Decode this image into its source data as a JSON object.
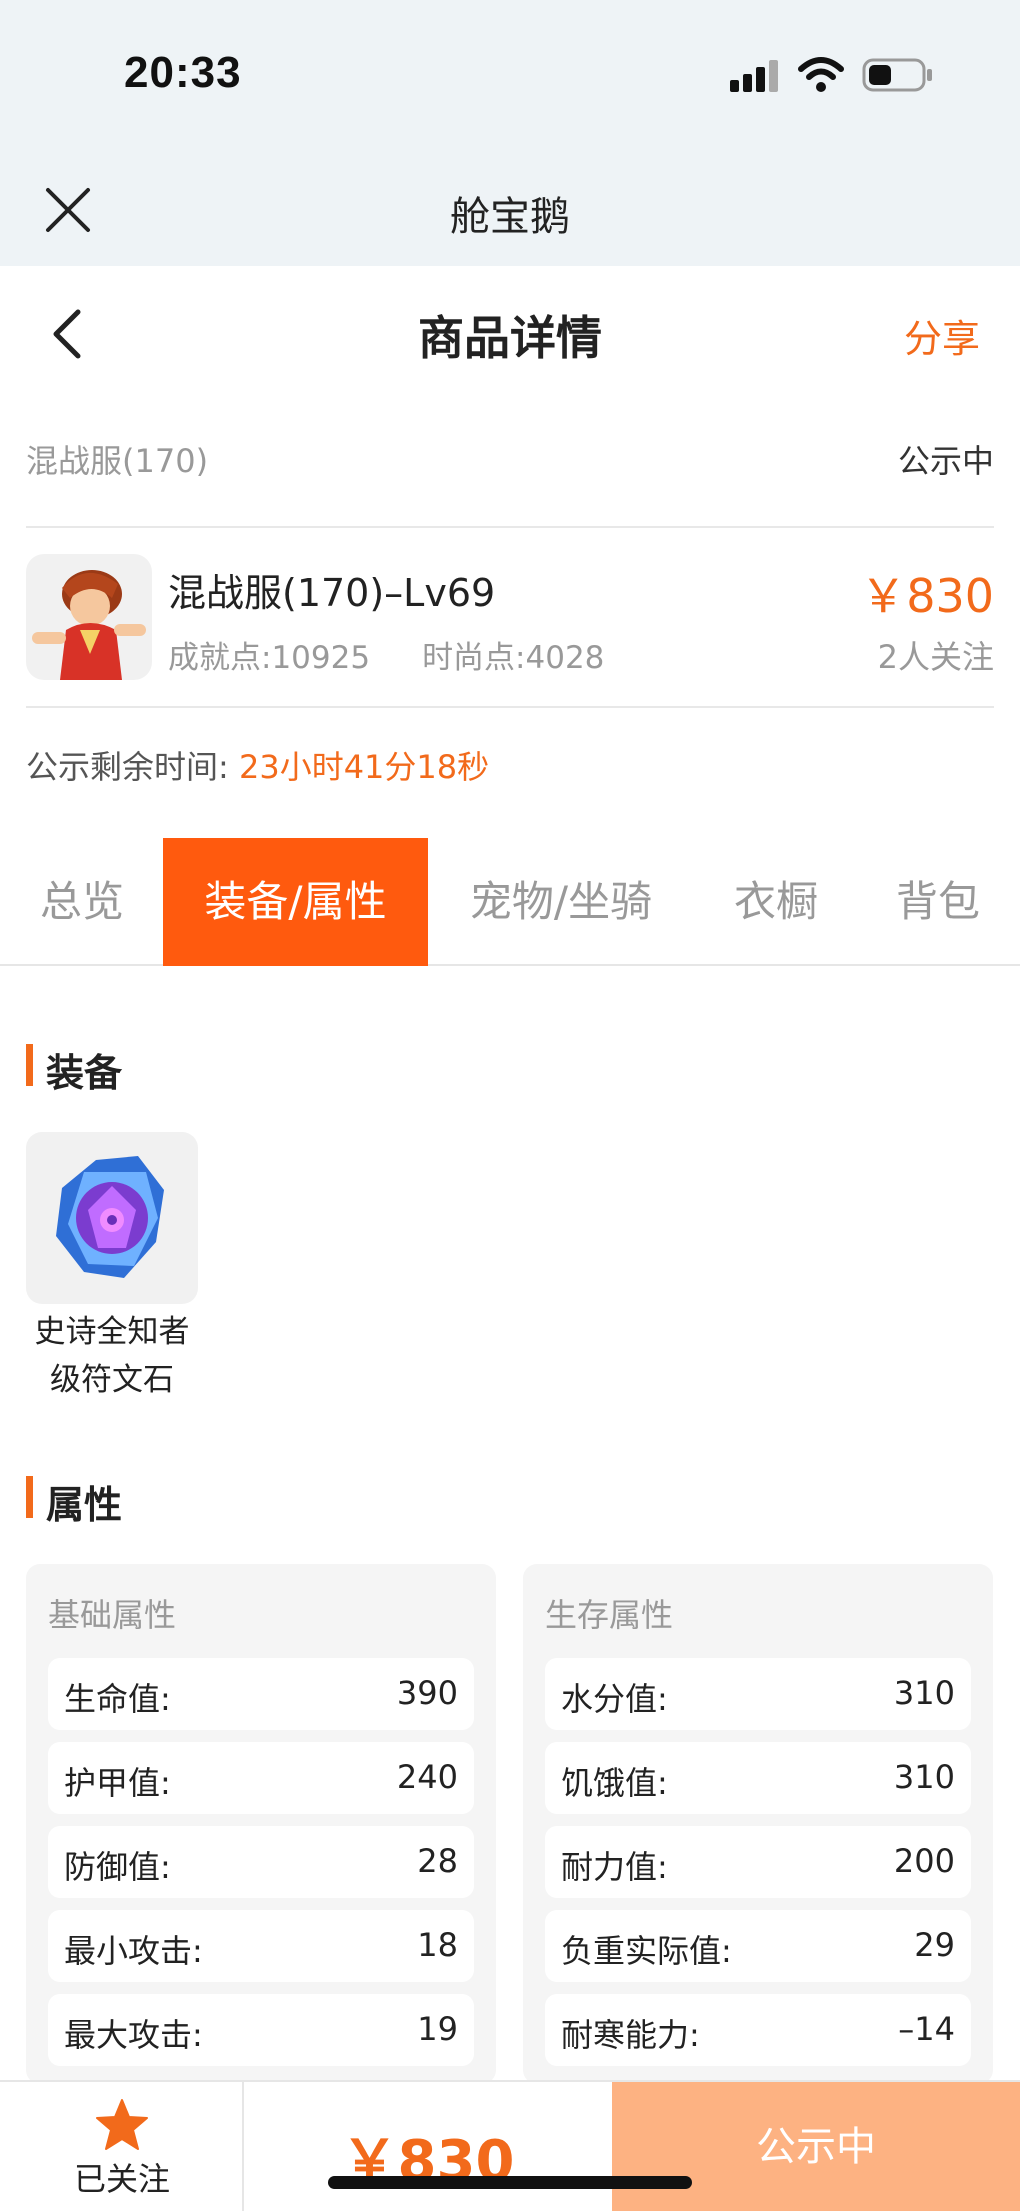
{
  "status_bar": {
    "time": "20:33"
  },
  "app_header": {
    "title": "舱宝鹅"
  },
  "nav": {
    "title": "商品详情",
    "share_label": "分享"
  },
  "listing": {
    "server": "混战服(170)",
    "status": "公示中",
    "item_name": "混战服(170)–Lv69",
    "achievement": "成就点:10925",
    "fashion": "时尚点:4028",
    "price": "￥830",
    "followers": "2人关注",
    "remaining_label": "公示剩余时间:",
    "remaining_value": "23小时41分18秒"
  },
  "tabs": [
    {
      "label": "总览",
      "active": false
    },
    {
      "label": "装备/属性",
      "active": true
    },
    {
      "label": "宠物/坐骑",
      "active": false
    },
    {
      "label": "衣橱",
      "active": false
    },
    {
      "label": "背包",
      "active": false
    }
  ],
  "equipment": {
    "title": "装备",
    "items": [
      {
        "name": "史诗全知者级符文石",
        "icon": "rune-stone-icon"
      }
    ]
  },
  "attributes": {
    "title": "属性",
    "basic": {
      "title": "基础属性",
      "rows": [
        {
          "label": "生命值:",
          "value": "390"
        },
        {
          "label": "护甲值:",
          "value": "240"
        },
        {
          "label": "防御值:",
          "value": "28"
        },
        {
          "label": "最小攻击:",
          "value": "18"
        },
        {
          "label": "最大攻击:",
          "value": "19"
        }
      ]
    },
    "survival": {
      "title": "生存属性",
      "rows": [
        {
          "label": "水分值:",
          "value": "310"
        },
        {
          "label": "饥饿值:",
          "value": "310"
        },
        {
          "label": "耐力值:",
          "value": "200"
        },
        {
          "label": "负重实际值:",
          "value": "29"
        },
        {
          "label": "耐寒能力:",
          "value": "–14"
        }
      ]
    }
  },
  "bottom_bar": {
    "follow_label": "已关注",
    "price": "￥830",
    "action_label": "公示中"
  },
  "colors": {
    "accent": "#f26a1b",
    "tab_active": "#ff5a0e",
    "action_button": "#fdb282",
    "header_bg": "#eef3f6"
  }
}
